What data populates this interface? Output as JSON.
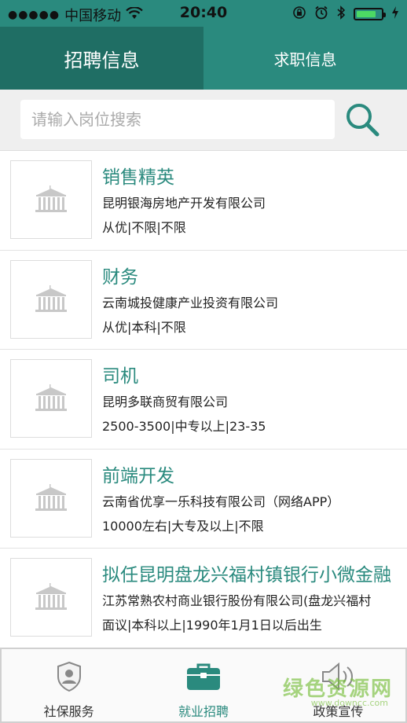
{
  "status_bar": {
    "signal": "●●●●●",
    "carrier": "中国移动",
    "time": "20:40"
  },
  "tabs": [
    {
      "label": "招聘信息",
      "active": true
    },
    {
      "label": "求职信息",
      "active": false
    }
  ],
  "search": {
    "placeholder": "请输入岗位搜索",
    "value": ""
  },
  "jobs": [
    {
      "title": "销售精英",
      "company": "昆明银海房地产开发有限公司",
      "meta": "从优|不限|不限"
    },
    {
      "title": "财务",
      "company": "云南城投健康产业投资有限公司",
      "meta": "从优|本科|不限"
    },
    {
      "title": "司机",
      "company": "昆明多联商贸有限公司",
      "meta": "2500-3500|中专以上|23-35"
    },
    {
      "title": "前端开发",
      "company": "云南省优享一乐科技有限公司（网络APP）",
      "meta": "10000左右|大专及以上|不限"
    },
    {
      "title": "拟任昆明盘龙兴福村镇银行小微金融",
      "company": "江苏常熟农村商业银行股份有限公司(盘龙兴福村",
      "meta": "面议|本科以上|1990年1月1日以后出生"
    }
  ],
  "bottom_nav": [
    {
      "label": "社保服务",
      "icon": "shield-person-icon",
      "active": false
    },
    {
      "label": "就业招聘",
      "icon": "briefcase-icon",
      "active": true
    },
    {
      "label": "政策宣传",
      "icon": "speaker-icon",
      "active": false
    }
  ],
  "watermark": {
    "text": "绿色资源网",
    "url": "www.downcc.com"
  },
  "colors": {
    "primary": "#2a8a7e",
    "primary_dark": "#1f6e64"
  }
}
